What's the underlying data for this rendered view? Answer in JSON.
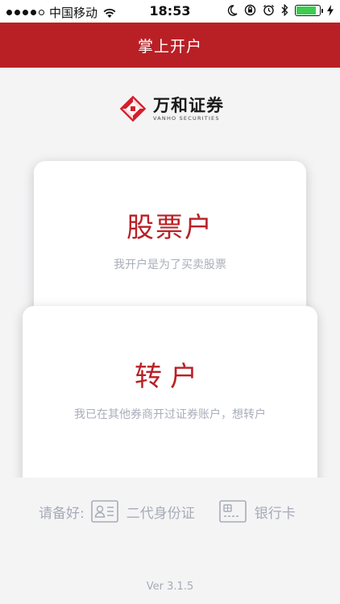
{
  "status_bar": {
    "carrier": "中国移动",
    "time": "18:53",
    "battery_level": 0.86
  },
  "nav": {
    "title": "掌上开户"
  },
  "logo": {
    "name_cn": "万和证券",
    "name_en": "VANHO SECURITIES"
  },
  "cards": {
    "stock": {
      "title": "股票户",
      "subtitle": "我开户是为了买卖股票"
    },
    "transfer": {
      "title": "转户",
      "subtitle": "我已在其他券商开过证券账户，想转户"
    }
  },
  "prepare": {
    "label": "请备好:",
    "id_card": "二代身份证",
    "bank_card": "银行卡"
  },
  "version": "Ver 3.1.5",
  "colors": {
    "brand": "#b92026",
    "muted": "#a6abb6"
  }
}
